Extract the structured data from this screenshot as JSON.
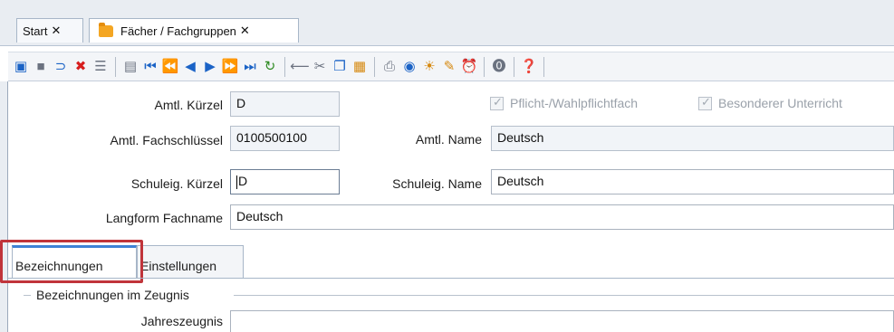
{
  "tabs": [
    {
      "label": "Start"
    },
    {
      "label": "Fächer / Fachgruppen"
    }
  ],
  "toolbar": {
    "icons": [
      "new-icon",
      "save-icon",
      "undo-icon",
      "delete-icon",
      "list-icon",
      "form-icon",
      "first-icon",
      "prev-page-icon",
      "prev-icon",
      "next-icon",
      "next-page-icon",
      "last-icon",
      "refresh-icon",
      "back-arrow-icon",
      "cut-icon",
      "copy-icon",
      "paste-icon",
      "print-icon",
      "preview-icon",
      "idea-icon",
      "clean-icon",
      "alarm-icon",
      "info-icon",
      "help-icon"
    ]
  },
  "form": {
    "amtl_kuerzel": {
      "label": "Amtl. Kürzel",
      "value": "D"
    },
    "pflicht": {
      "label": "Pflicht-/Wahlpflichtfach"
    },
    "besonderer": {
      "label": "Besonderer Unterricht"
    },
    "amtl_fachschluessel": {
      "label": "Amtl.  Fachschlüssel",
      "value": "0100500100"
    },
    "amtl_name": {
      "label": "Amtl. Name",
      "value": "Deutsch"
    },
    "schuleig_kuerzel": {
      "label": "Schuleig. Kürzel",
      "value": "D"
    },
    "schuleig_name": {
      "label": "Schuleig. Name",
      "value": "Deutsch"
    },
    "langform": {
      "label": "Langform Fachname",
      "value": "Deutsch"
    }
  },
  "subtabs": [
    {
      "label": "Bezeichnungen"
    },
    {
      "label": "Einstellungen"
    }
  ],
  "zeugnis": {
    "group_title": "Bezeichnungen im Zeugnis",
    "jahreszeugnis": {
      "label": "Jahreszeugnis",
      "value": ""
    }
  }
}
